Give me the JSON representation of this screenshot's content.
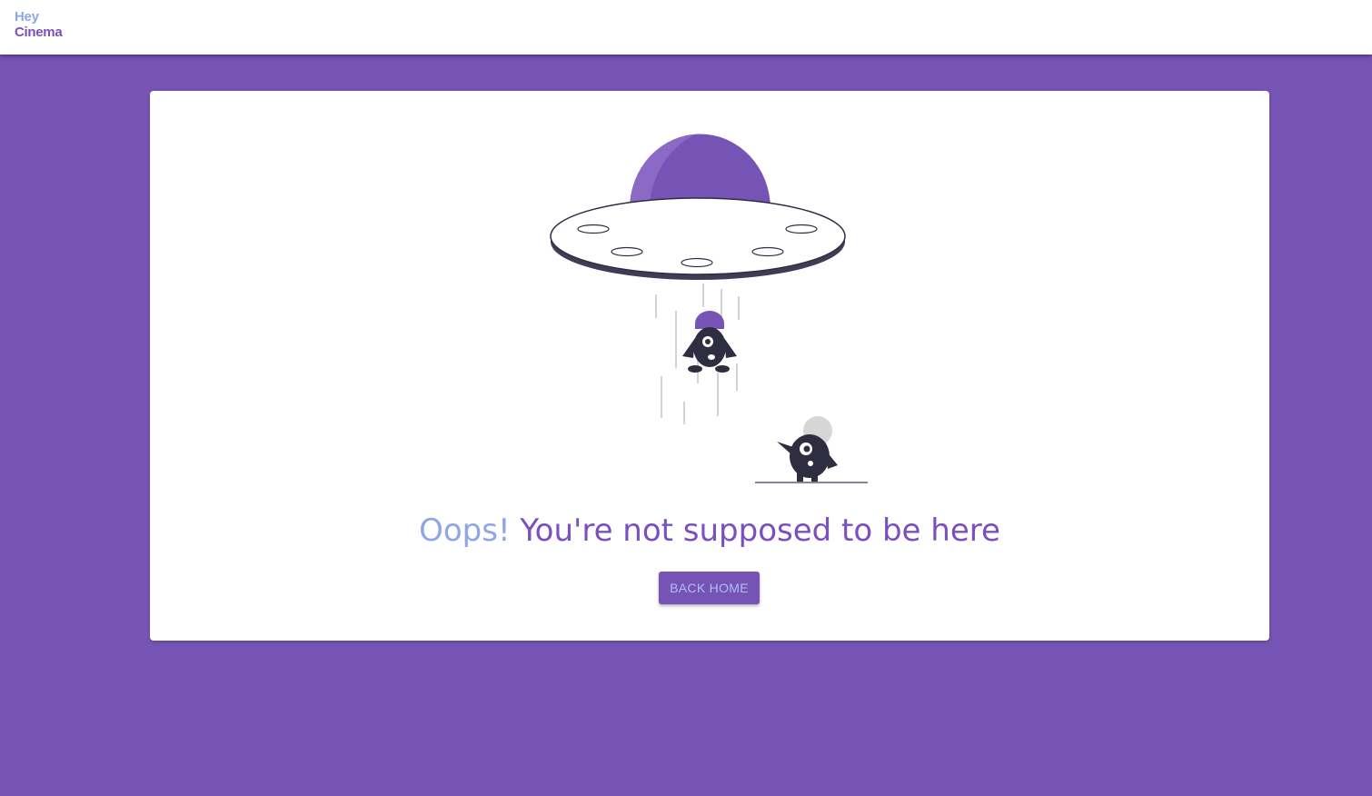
{
  "brand": {
    "line1": "Hey",
    "line2": "Cinema"
  },
  "error": {
    "oops": "Oops!",
    "message": "You're not supposed to be here",
    "button_label": "BACK HOME"
  },
  "illustration": {
    "name": "ufo-abduction-illustration"
  },
  "colors": {
    "background": "#7654b6",
    "accent_light": "#8fa6e4",
    "accent_dark": "#7a4fc0",
    "card": "#ffffff",
    "ink": "#2f2e41"
  }
}
